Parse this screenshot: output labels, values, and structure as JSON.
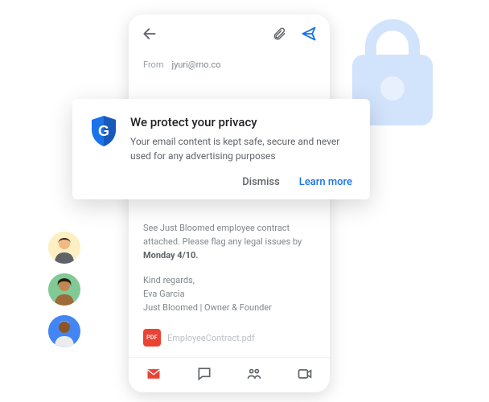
{
  "phone": {
    "from_label": "From",
    "from_value": "jyuri@mo.co"
  },
  "email": {
    "body_line1": "See Just Bloomed employee contract attached. Please flag any legal issues by ",
    "body_bold": "Monday 4/10.",
    "sig_line1": "Kind regards,",
    "sig_line2": "Eva Garcia",
    "sig_line3": "Just Bloomed | Owner & Founder",
    "attachment_name": "EmployeeContract.pdf",
    "pdf_label": "PDF"
  },
  "privacy": {
    "shield_letter": "G",
    "title": "We protect your privacy",
    "body": "Your email content is kept safe, secure and never used for any advertising purposes",
    "dismiss_label": "Dismiss",
    "learn_label": "Learn more"
  },
  "colors": {
    "google_blue": "#1a73e8",
    "google_red": "#ea4335",
    "lock_fill": "#d2e3fc"
  }
}
